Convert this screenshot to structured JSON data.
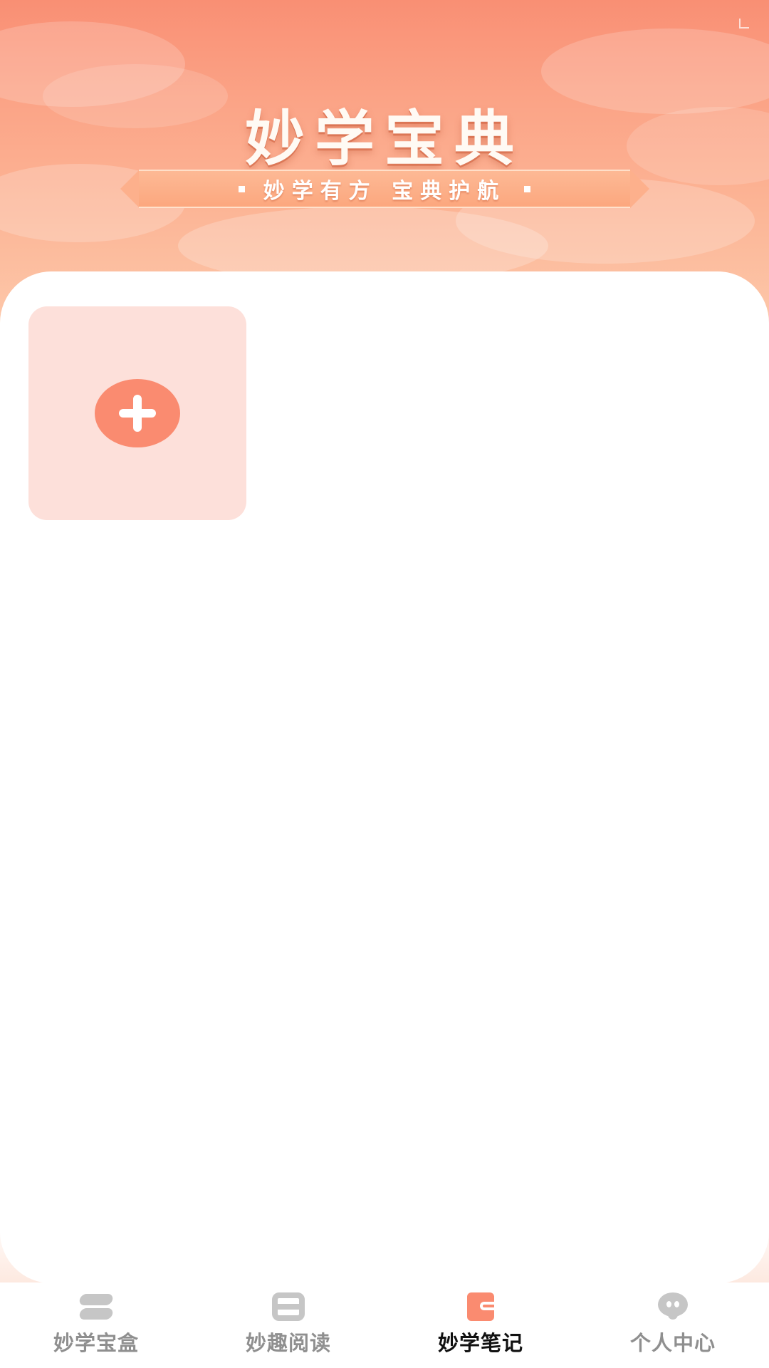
{
  "header": {
    "title": "妙学宝典",
    "slogan": "妙学有方  宝典护航"
  },
  "notes": {
    "add_tile_icon": "plus-icon"
  },
  "tab_bar": {
    "active_index": 2,
    "accent_color": "#fa8b70",
    "tabs": [
      {
        "label": "妙学宝盒",
        "icon": "box-icon"
      },
      {
        "label": "妙趣阅读",
        "icon": "reading-icon"
      },
      {
        "label": "妙学笔记",
        "icon": "note-icon"
      },
      {
        "label": "个人中心",
        "icon": "person-icon"
      }
    ]
  }
}
